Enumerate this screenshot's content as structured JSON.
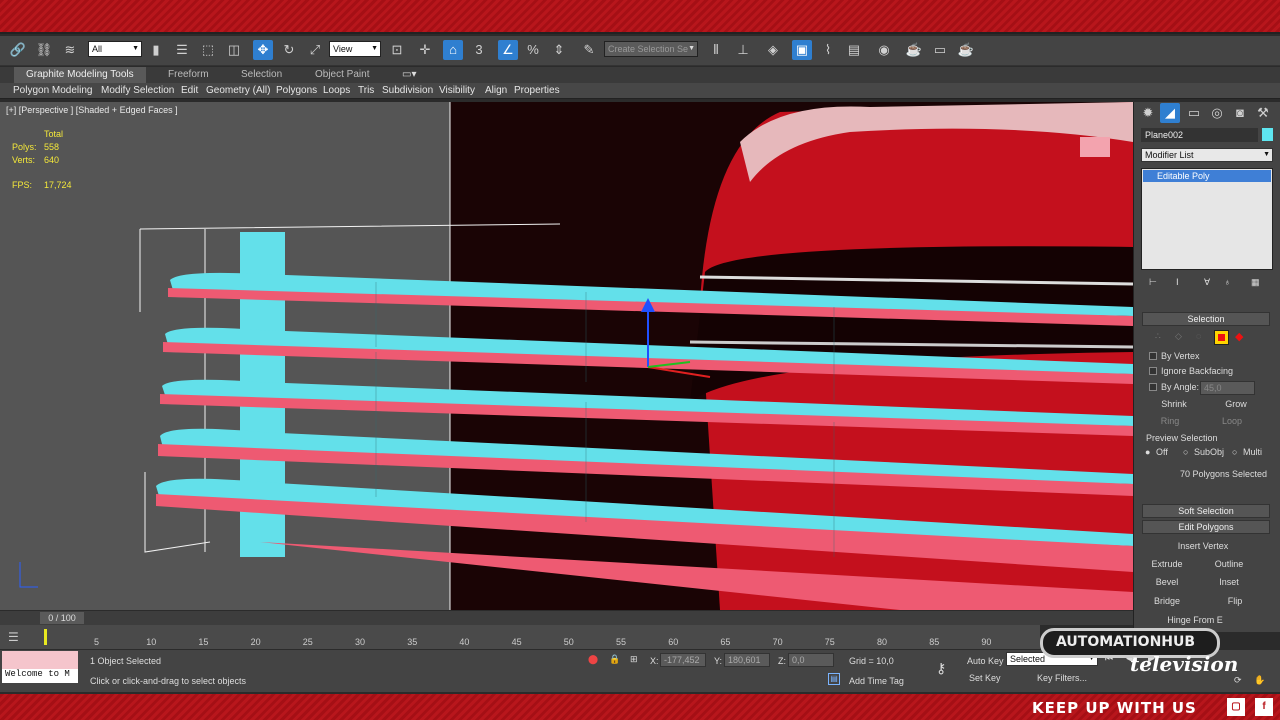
{
  "toolbar": {
    "selection_filter": "All",
    "ref_coord": "View",
    "snap_number": "3",
    "named_selection_placeholder": "Create Selection Se",
    "icons": [
      "link-icon",
      "unlink-icon",
      "bind-icon",
      "select-icon",
      "select-by-name-icon",
      "rect-region-icon",
      "window-crossing-icon",
      "move-icon",
      "rotate-icon",
      "scale-icon",
      "pivot-icon",
      "select-manipulate-icon",
      "keyboard-shortcut-icon",
      "snap-icon",
      "angle-snap-icon",
      "percent-snap-icon",
      "spinner-snap-icon",
      "edit-named-sel-icon",
      "mirror-icon",
      "align-icon",
      "layer-icon",
      "graphite-icon",
      "curve-editor-icon",
      "schematic-icon",
      "material-editor-icon",
      "render-setup-icon",
      "rendered-frame-icon",
      "render-icon",
      "render-iterative-icon"
    ]
  },
  "ribbon": {
    "tabs": [
      "Graphite Modeling Tools",
      "Freeform",
      "Selection",
      "Object Paint"
    ],
    "active_tab": "Graphite Modeling Tools",
    "panels": [
      "Polygon Modeling",
      "Modify Selection",
      "Edit",
      "Geometry (All)",
      "Polygons",
      "Loops",
      "Tris",
      "Subdivision",
      "Visibility",
      "Align",
      "Properties"
    ]
  },
  "viewport": {
    "label": "[+] [Perspective ] [Shaded + Edged Faces ]",
    "stats": {
      "total_label": "Total",
      "polys_label": "Polys:",
      "polys": "558",
      "verts_label": "Verts:",
      "verts": "640",
      "fps_label": "FPS:",
      "fps": "17,724"
    }
  },
  "command_panel": {
    "object_name": "Plane002",
    "modifier_list": "Modifier List",
    "stack_item": "Editable Poly",
    "selection": {
      "title": "Selection",
      "by_vertex": "By Vertex",
      "ignore_backfacing": "Ignore Backfacing",
      "by_angle": "By Angle:",
      "angle_value": "45,0",
      "shrink": "Shrink",
      "grow": "Grow",
      "ring": "Ring",
      "loop": "Loop",
      "preview_title": "Preview Selection",
      "preview_off": "Off",
      "preview_subobj": "SubObj",
      "preview_multi": "Multi",
      "selected_info": "70 Polygons Selected"
    },
    "soft_selection": "Soft Selection",
    "edit_polygons": {
      "title": "Edit Polygons",
      "insert_vertex": "Insert Vertex",
      "extrude": "Extrude",
      "outline": "Outline",
      "bevel": "Bevel",
      "inset": "Inset",
      "bridge": "Bridge",
      "flip": "Flip",
      "hinge": "Hinge From E"
    }
  },
  "timeline": {
    "slider": "0 / 100",
    "ticks": [
      "5",
      "10",
      "15",
      "20",
      "25",
      "30",
      "35",
      "40",
      "45",
      "50",
      "55",
      "60",
      "65",
      "70",
      "75",
      "80",
      "85",
      "90"
    ]
  },
  "status": {
    "script_listener": "Welcome to M",
    "selected": "1 Object Selected",
    "prompt": "Click or click-and-drag to select objects",
    "x_label": "X:",
    "x_value": "-177,452",
    "y_label": "Y:",
    "y_value": "180,601",
    "z_label": "Z:",
    "z_value": "0,0",
    "grid": "Grid = 10,0",
    "add_time_tag": "Add Time Tag",
    "auto_key": "Auto Key",
    "set_key": "Set Key",
    "key_mode": "Selected",
    "key_filters": "Key Filters..."
  },
  "overlay": {
    "logo_text": "AUTOMATIONHUB",
    "logo_sub": "television",
    "footer_text": "KEEP UP WITH US"
  },
  "colors": {
    "accent_blue": "#2f7fd0",
    "poly_cyan": "#63e0ea",
    "poly_red": "#ee5a72",
    "brand_red": "#b8161c",
    "stat_yellow": "#f4e83a"
  }
}
